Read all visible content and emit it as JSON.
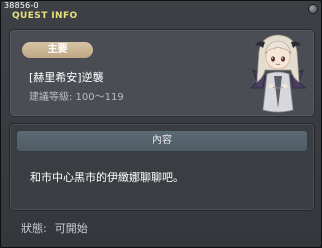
{
  "quest_id": "38856-0",
  "window_title": "QUEST INFO",
  "info": {
    "category": "主要",
    "quest_name": "[赫里希安]逆襲",
    "recommended_level": "建議等級: 100～119"
  },
  "content": {
    "header": "內容",
    "text": "和市中心黑市的伊緻娜聊聊吧。"
  },
  "status": {
    "label": "狀態:",
    "value": "可開始"
  },
  "colors": {
    "title_yellow": "#e8e07a",
    "badge_tan": "#c9b28e",
    "content_header": "#566470"
  }
}
